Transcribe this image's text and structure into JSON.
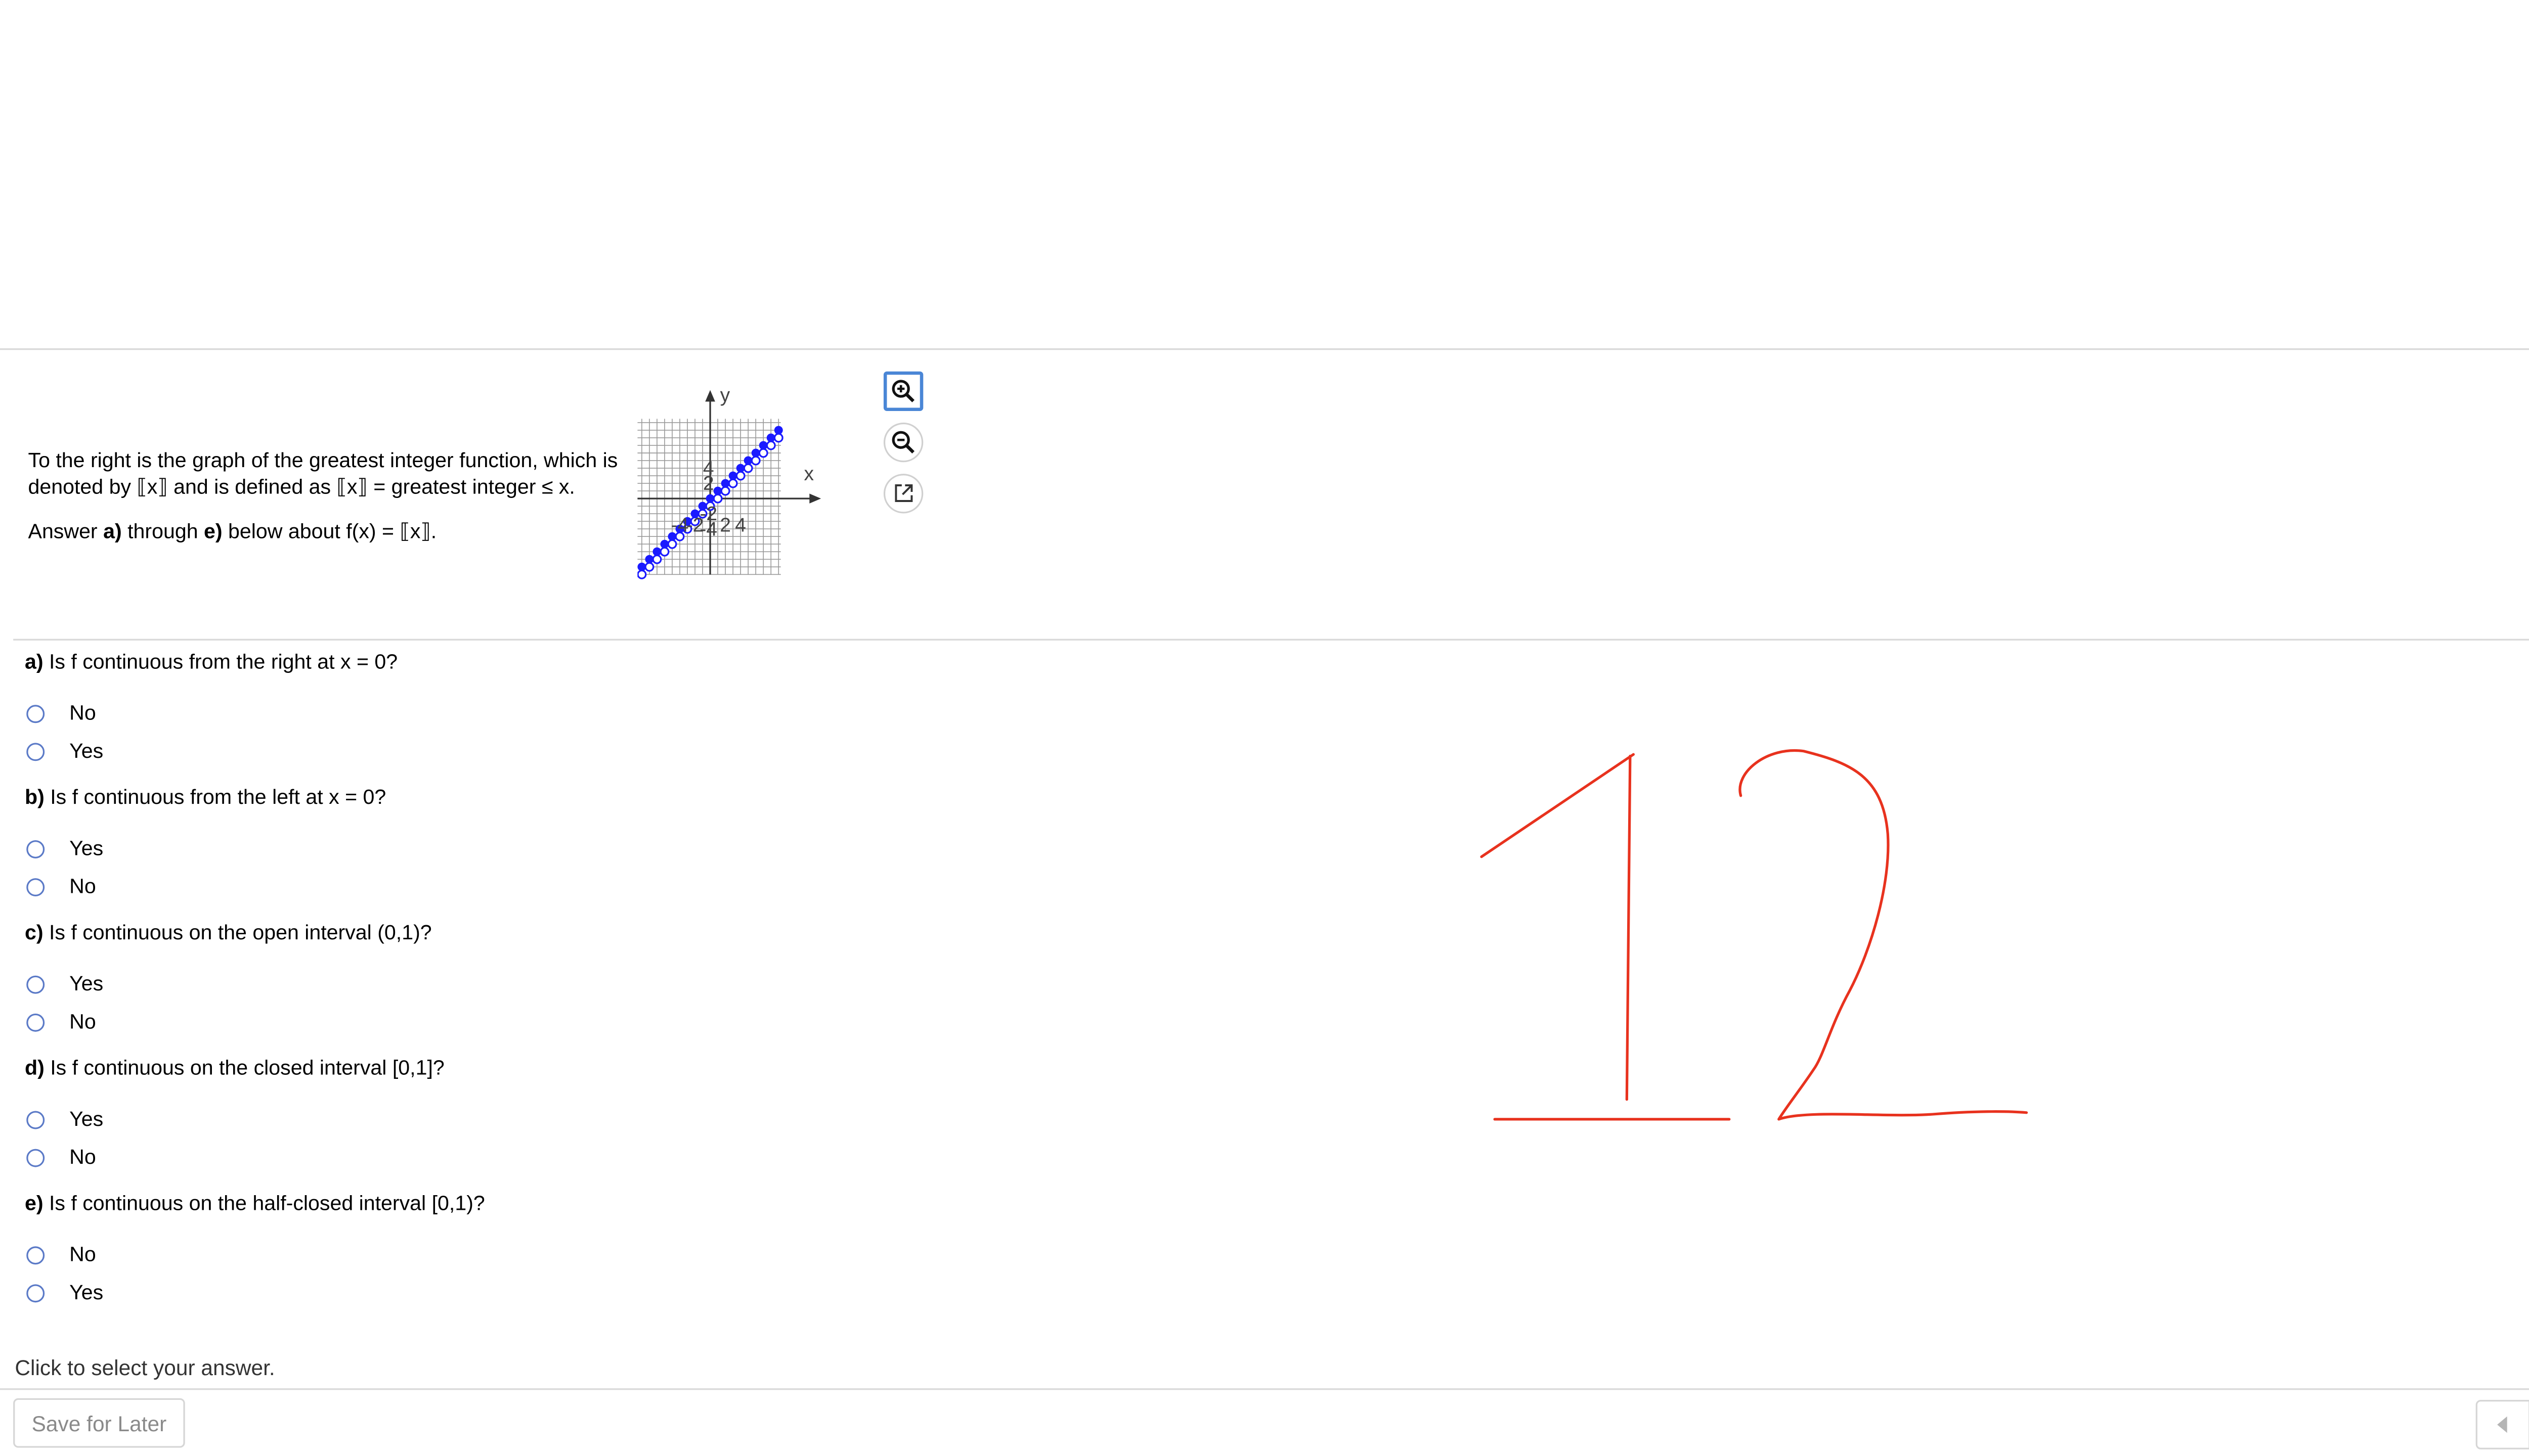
{
  "intro": {
    "line1": "To the right is the graph of the greatest integer function, which is denoted by ⟦x⟧ and is defined as ⟦x⟧ = greatest integer ≤ x.",
    "line2_a": "Answer ",
    "line2_b": "a)",
    "line2_c": " through ",
    "line2_d": "e)",
    "line2_e": " below about f(x) = ⟦x⟧."
  },
  "graph": {
    "x_axis_label": "x",
    "y_axis_label": "y",
    "x_tick_labels": [
      "-4",
      "-2",
      "2",
      "4"
    ],
    "y_tick_labels": [
      "4",
      "2",
      "-2",
      "-4"
    ]
  },
  "tools": [
    "zoom-in-icon",
    "zoom-out-icon",
    "popout-icon"
  ],
  "questions": [
    {
      "label": "a)",
      "text": " Is f continuous from the right at x = 0?",
      "options": [
        "No",
        "Yes"
      ]
    },
    {
      "label": "b)",
      "text": " Is f continuous from the left at x = 0?",
      "options": [
        "Yes",
        "No"
      ]
    },
    {
      "label": "c)",
      "text": " Is f continuous on the open interval (0,1)?",
      "options": [
        "Yes",
        "No"
      ]
    },
    {
      "label": "d)",
      "text": " Is f continuous on the closed interval [0,1]?",
      "options": [
        "Yes",
        "No"
      ]
    },
    {
      "label": "e)",
      "text": " Is f continuous on the half-closed interval [0,1)?",
      "options": [
        "No",
        "Yes"
      ]
    }
  ],
  "status_text": "Click to select your answer.",
  "help_glyph": "?",
  "save_label": "Save for Later",
  "colors": {
    "graph_points": "#1a1aff",
    "ink": "#e8321e",
    "radio": "#5b7ac7",
    "help": "#f4c430"
  }
}
